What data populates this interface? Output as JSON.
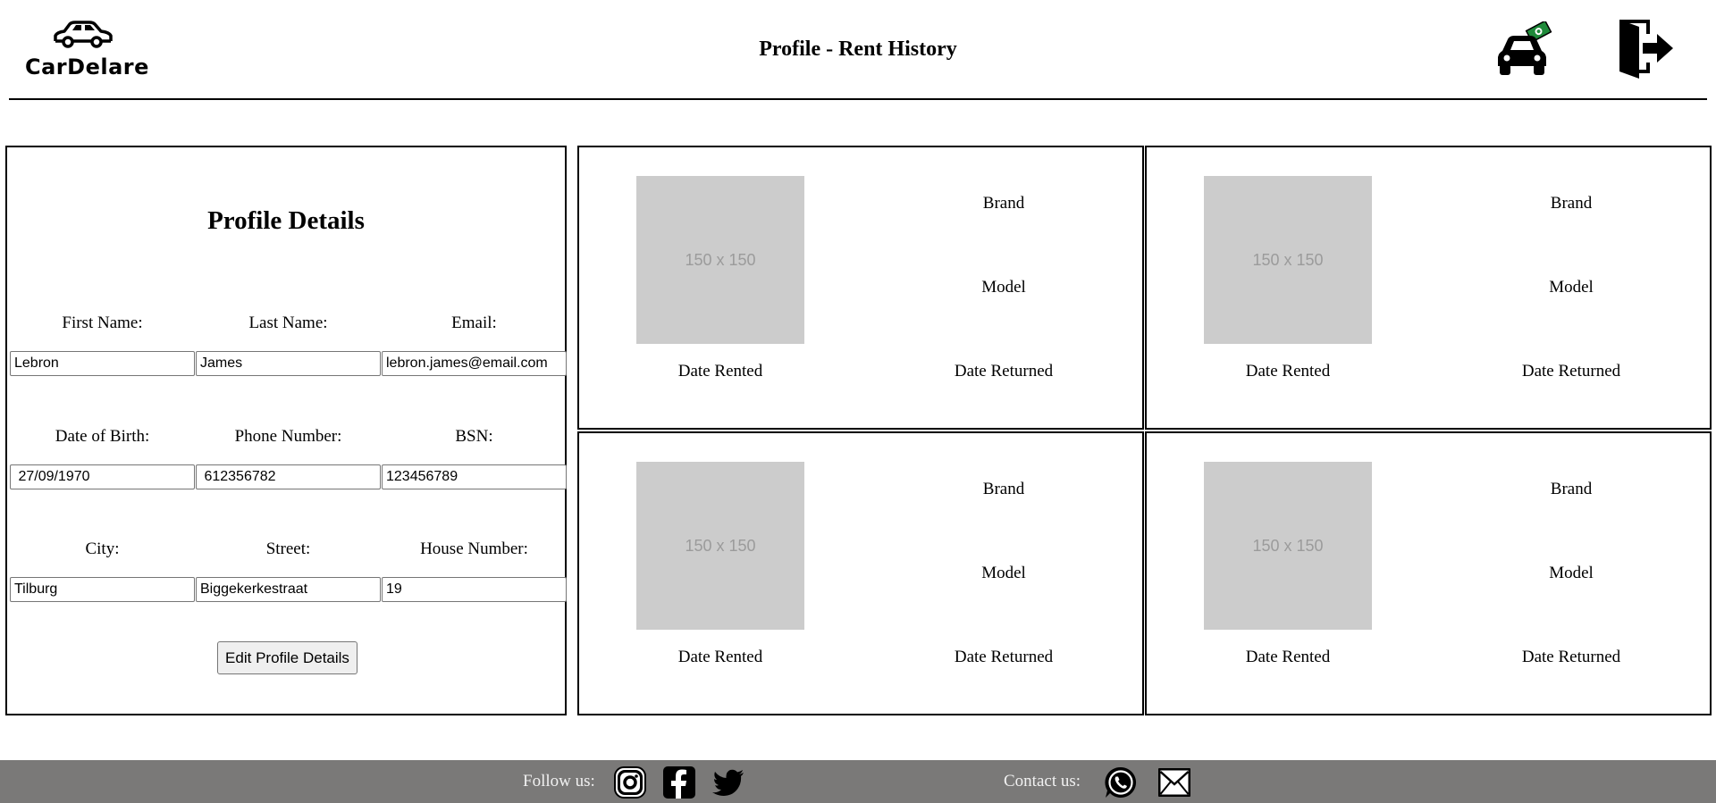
{
  "header": {
    "logo_text": "CarDelare",
    "title": "Profile - Rent History"
  },
  "profile": {
    "title": "Profile Details",
    "fields": [
      {
        "label": "First Name:",
        "value": "Lebron"
      },
      {
        "label": "Last Name:",
        "value": "James"
      },
      {
        "label": "Email:",
        "value": "lebron.james@email.com"
      },
      {
        "label": "Date of Birth:",
        "value": " 27/09/1970"
      },
      {
        "label": "Phone Number:",
        "value": " 612356782"
      },
      {
        "label": "BSN:",
        "value": "123456789"
      },
      {
        "label": "City:",
        "value": "Tilburg"
      },
      {
        "label": "Street:",
        "value": "Biggekerkestraat"
      },
      {
        "label": "House Number:",
        "value": "19"
      }
    ],
    "edit_button": "Edit Profile Details"
  },
  "rentals": [
    {
      "image_placeholder": "150 x 150",
      "brand": "Brand",
      "model": "Model",
      "date_rented": "Date Rented",
      "date_returned": "Date Returned"
    },
    {
      "image_placeholder": "150 x 150",
      "brand": "Brand",
      "model": "Model",
      "date_rented": "Date Rented",
      "date_returned": "Date Returned"
    },
    {
      "image_placeholder": "150 x 150",
      "brand": "Brand",
      "model": "Model",
      "date_rented": "Date Rented",
      "date_returned": "Date Returned"
    },
    {
      "image_placeholder": "150 x 150",
      "brand": "Brand",
      "model": "Model",
      "date_rented": "Date Rented",
      "date_returned": "Date Returned"
    }
  ],
  "footer": {
    "follow_label": "Follow us:",
    "contact_label": "Contact us:",
    "follow_icons": [
      "instagram-icon",
      "facebook-icon",
      "twitter-icon"
    ],
    "contact_icons": [
      "whatsapp-icon",
      "mail-icon"
    ]
  },
  "colors": {
    "footer_bg": "#7a7978",
    "image_placeholder_bg": "#cccccc",
    "money_green": "#1f8a3a"
  }
}
